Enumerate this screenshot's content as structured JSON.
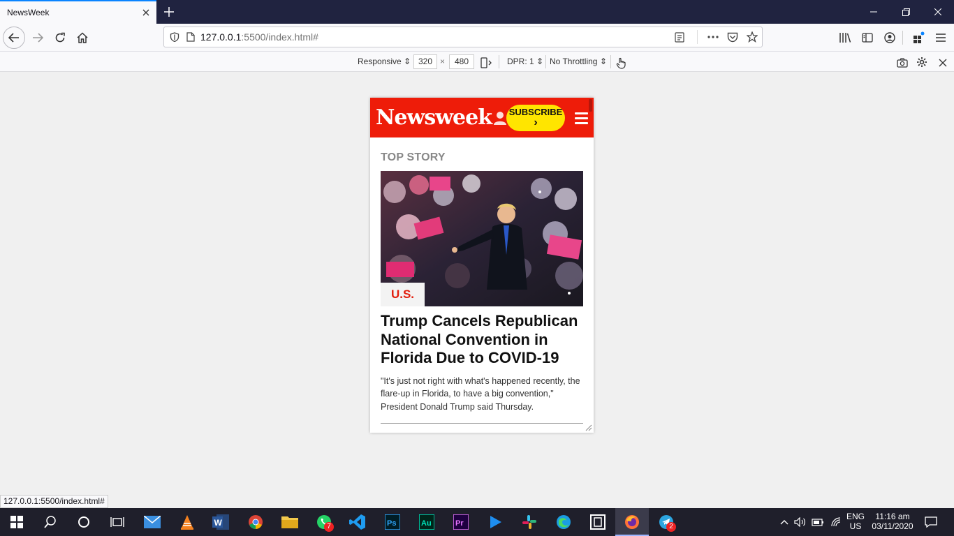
{
  "browser": {
    "tab_title": "NewsWeek",
    "url_host": "127.0.0.1",
    "url_rest": ":5500/index.html#",
    "status_url": "127.0.0.1:5500/index.html#"
  },
  "rdm": {
    "device": "Responsive",
    "width": "320",
    "times": "×",
    "height": "480",
    "dpr": "DPR: 1",
    "throttling": "No Throttling"
  },
  "site": {
    "logo": "Newsweek",
    "subscribe_label": "SUBSCRIBE",
    "subscribe_arrow": "›",
    "section_heading": "TOP STORY",
    "story": {
      "category": "U.S.",
      "headline": "Trump Cancels Republican National Convention in Florida Due to COVID-19",
      "summary": "\"It's just not right with what's happened recently, the flare-up in Florida, to have a big convention,\" President Donald Trump said Thursday."
    },
    "colors": {
      "brand_red": "#ee1c09",
      "subscribe_yellow": "#ffe500"
    }
  },
  "taskbar": {
    "lang_top": "ENG",
    "lang_bottom": "US",
    "time": "11:16 am",
    "date": "03/11/2020",
    "whatsapp_badge": "7",
    "telegram_badge": "2"
  }
}
